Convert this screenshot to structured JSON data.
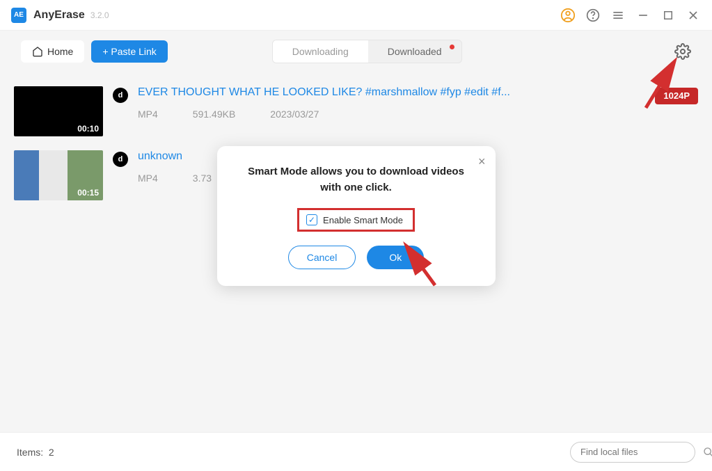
{
  "titlebar": {
    "app_name": "AnyErase",
    "version": "3.2.0",
    "logo_text": "AE"
  },
  "toolbar": {
    "home_label": "Home",
    "paste_label": "+ Paste Link",
    "tabs": {
      "downloading": "Downloading",
      "downloaded": "Downloaded"
    }
  },
  "downloads": [
    {
      "title": "EVER THOUGHT WHAT HE LOOKED LIKE? #marshmallow #fyp #edit #f...",
      "format": "MP4",
      "size": "591.49KB",
      "date": "2023/03/27",
      "duration": "00:10",
      "quality": "1024P",
      "platform": "d"
    },
    {
      "title": "unknown",
      "format": "MP4",
      "size": "3.73",
      "date": "",
      "duration": "00:15",
      "quality": "",
      "platform": "d"
    }
  ],
  "modal": {
    "message": "Smart Mode allows you to download videos with one click.",
    "checkbox_label": "Enable Smart Mode",
    "cancel_label": "Cancel",
    "ok_label": "Ok",
    "checkbox_checked": true
  },
  "footer": {
    "items_label": "Items:",
    "items_count": "2",
    "search_placeholder": "Find local files"
  }
}
